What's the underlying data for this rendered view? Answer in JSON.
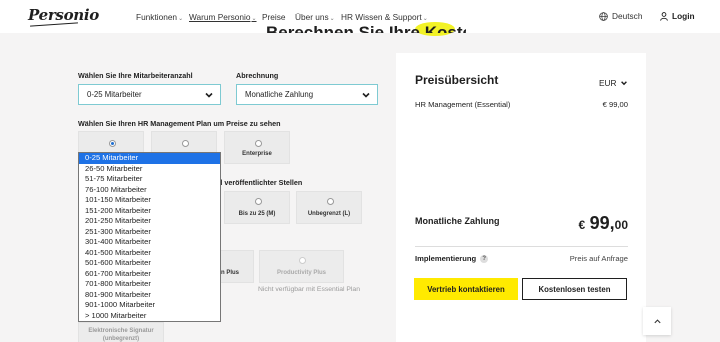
{
  "nav": {
    "logo": "Personio",
    "items": [
      {
        "label": "Funktionen",
        "caret": true,
        "active": false
      },
      {
        "label": "Warum Personio",
        "caret": true,
        "active": true
      },
      {
        "label": "Preise",
        "caret": false,
        "active": false
      },
      {
        "label": "Über uns",
        "caret": true,
        "active": false
      },
      {
        "label": "HR Wissen & Support",
        "caret": true,
        "active": false
      }
    ],
    "language": "Deutsch",
    "login": "Login"
  },
  "heading": "Berechnen Sie Ihre Kosten",
  "form": {
    "employee_label": "Wählen Sie Ihre Mitarbeiteranzahl",
    "employee_value": "0-25 Mitarbeiter",
    "billing_label": "Abrechnung",
    "billing_value": "Monatliche Zahlung",
    "plan_label": "Wählen Sie Ihren HR Management Plan um Preise zu sehen",
    "plans": [
      {
        "name": "",
        "selected": true
      },
      {
        "name": "",
        "selected": false
      },
      {
        "name": "Enterprise",
        "selected": false
      }
    ],
    "jobs_label_partial": "anzahl veröffentlichter Stellen",
    "job_options": [
      "Bis zu 25 (M)",
      "Unbegrenzt (L)"
    ],
    "addon_partial": "n Plus",
    "productivity_plus": "Productivity Plus",
    "productivity_note": "Nicht verfügbar mit Essential Plan",
    "esignature": "Elektronische Signatur",
    "esignature_sub": "(unbegrenzt)"
  },
  "dropdown": {
    "options": [
      "0-25 Mitarbeiter",
      "26-50 Mitarbeiter",
      "51-75 Mitarbeiter",
      "76-100 Mitarbeiter",
      "101-150 Mitarbeiter",
      "151-200 Mitarbeiter",
      "201-250 Mitarbeiter",
      "251-300 Mitarbeiter",
      "301-400 Mitarbeiter",
      "401-500 Mitarbeiter",
      "501-600 Mitarbeiter",
      "601-700 Mitarbeiter",
      "701-800 Mitarbeiter",
      "801-900 Mitarbeiter",
      "901-1000 Mitarbeiter",
      "> 1000 Mitarbeiter"
    ],
    "selected_index": 0
  },
  "summary": {
    "title": "Preisübersicht",
    "currency": "EUR",
    "line_item": "HR Management (Essential)",
    "line_price": "€ 99,00",
    "monthly_label": "Monatliche Zahlung",
    "total_currency": "€",
    "total_main": "99,",
    "total_cents": "00",
    "impl_label": "Implementierung",
    "impl_help": "?",
    "impl_value": "Preis auf Anfrage",
    "cta_primary": "Vertrieb kontaktieren",
    "cta_secondary": "Kostenlosen testen"
  },
  "colors": {
    "accent_yellow": "#ffea00",
    "select_border": "#7ecad2",
    "dropdown_selected": "#1e72e6",
    "page_bg": "#f5f4f4"
  }
}
